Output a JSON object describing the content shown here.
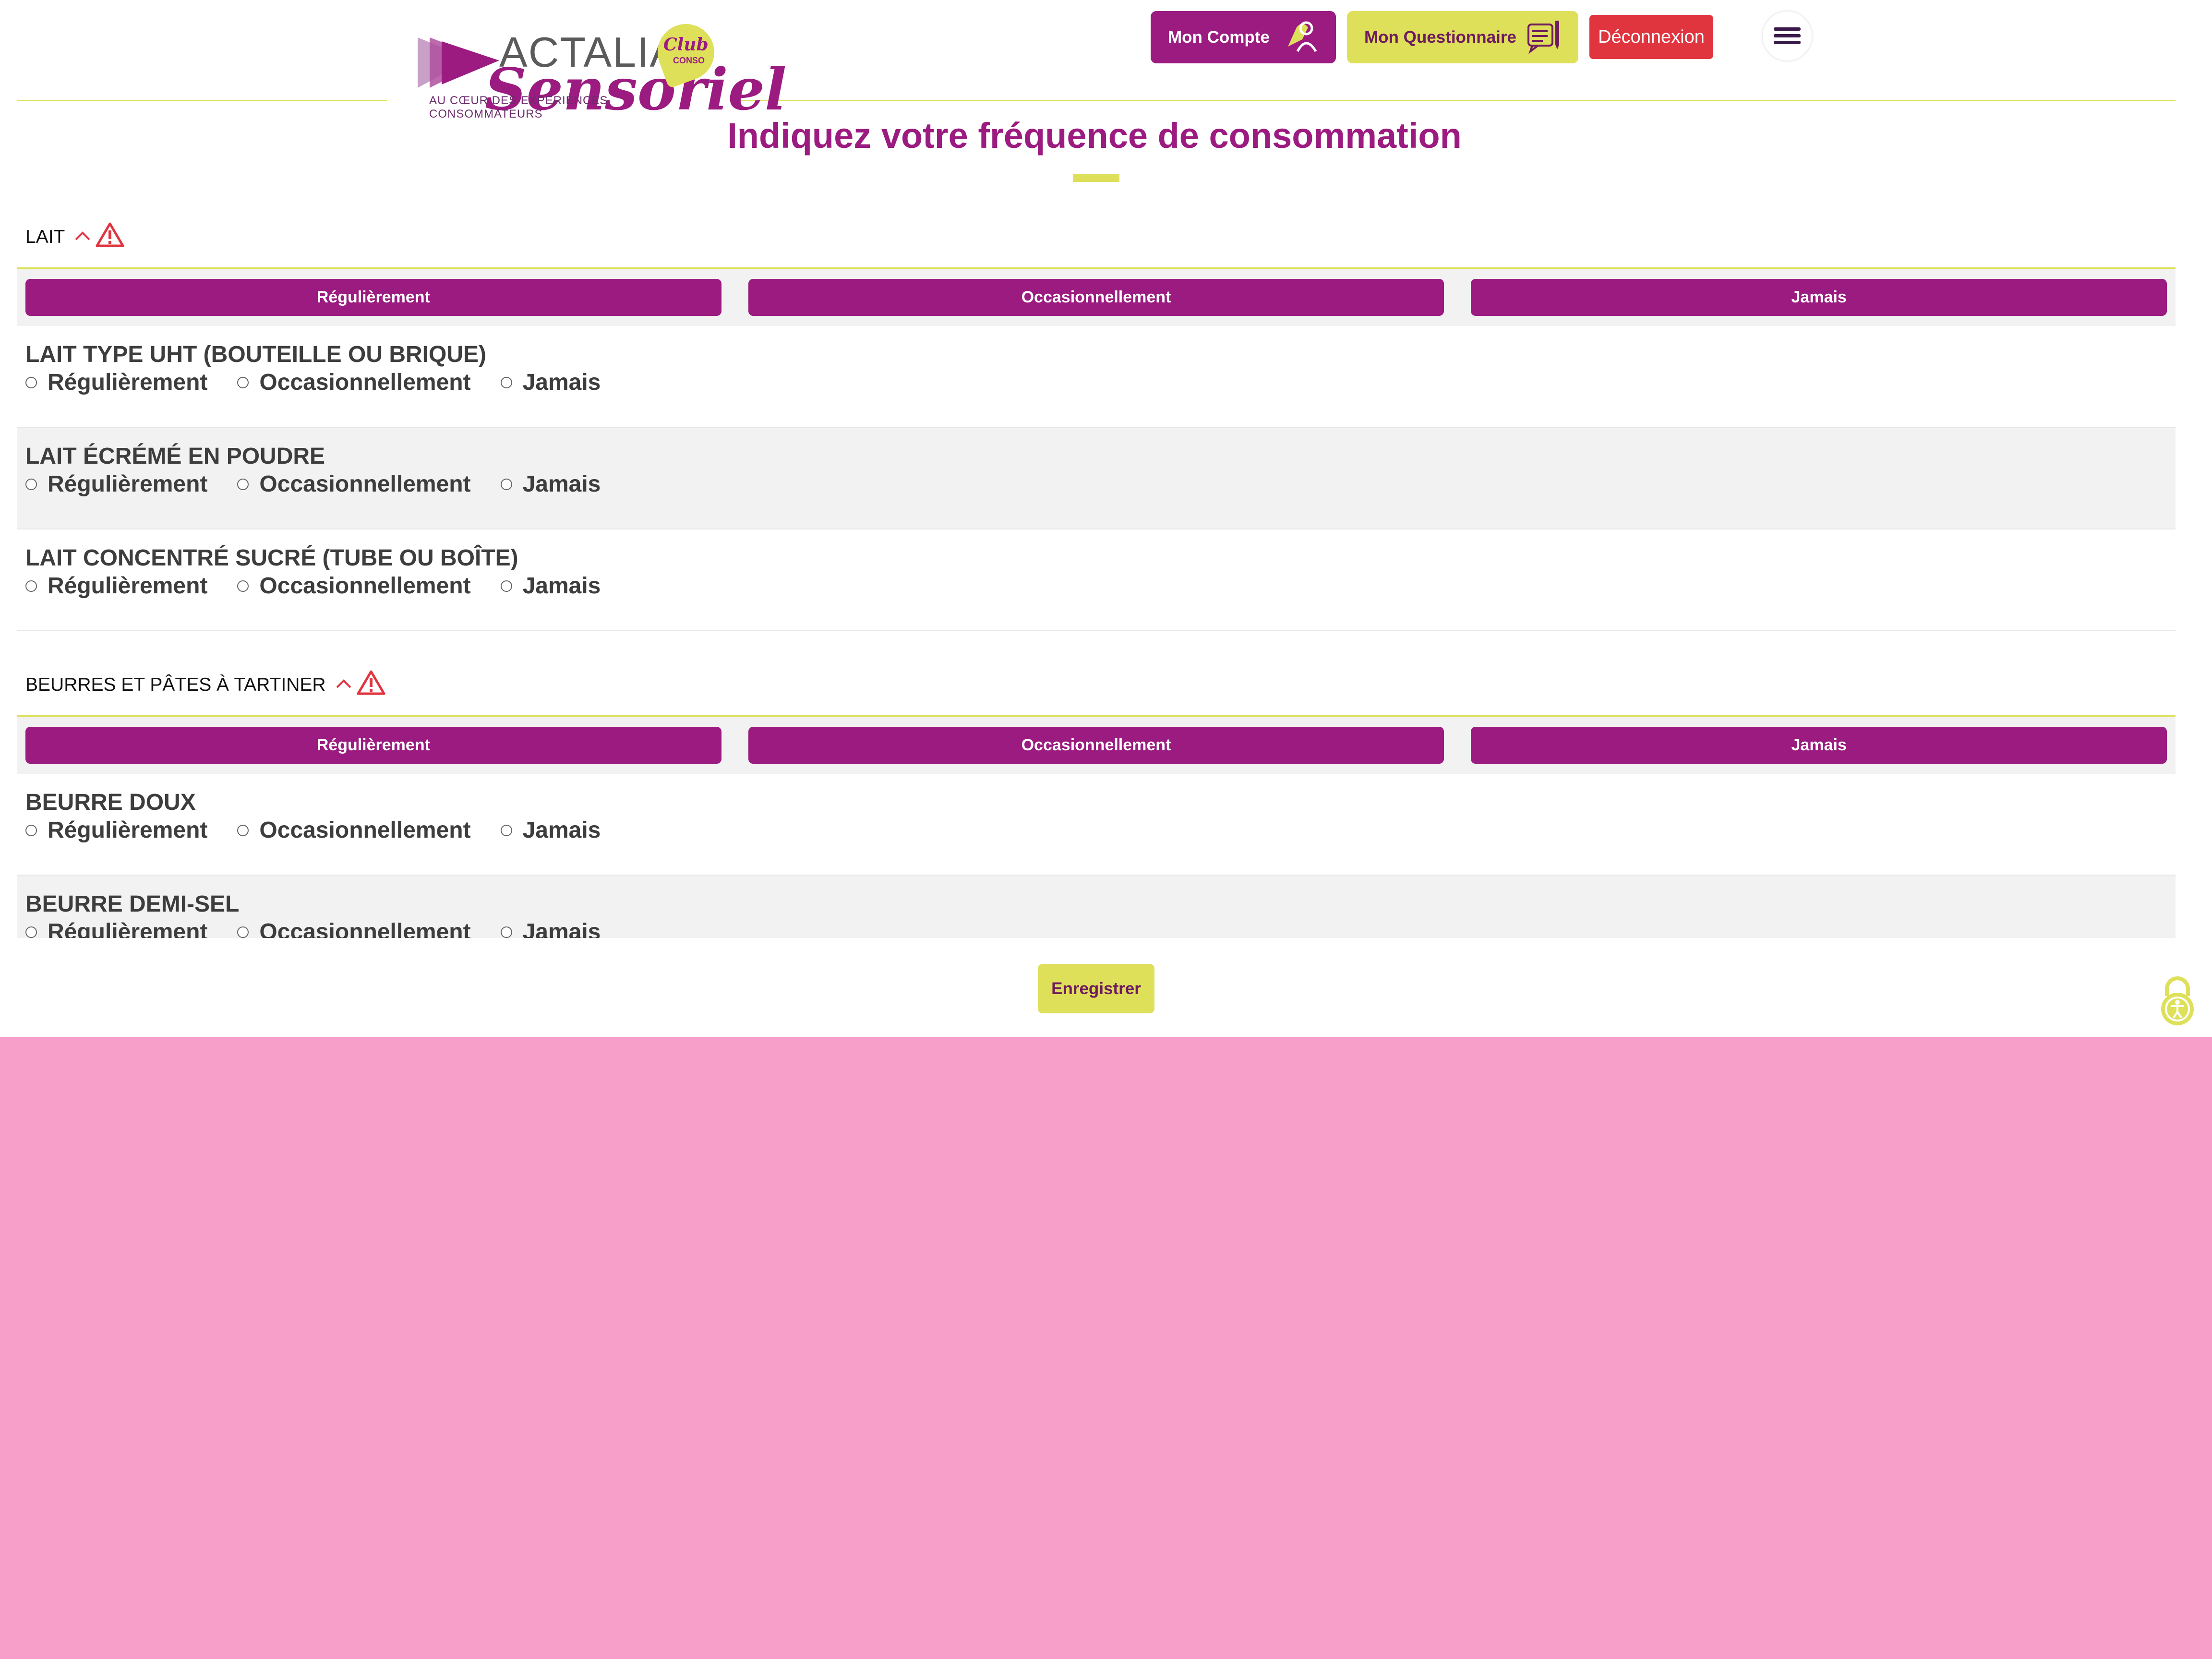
{
  "header": {
    "logo_wordmark": "ACTALIA",
    "logo_script": "Sensoriel",
    "logo_badge": "Club",
    "logo_badge_sub": "CONSO",
    "logo_tagline": "AU CŒUR DES EXPÉRIENCES CONSOMMATEURS",
    "buttons": {
      "account": "Mon Compte",
      "questionnaire": "Mon Questionnaire",
      "logout": "Déconnexion"
    },
    "menu_icon": "hamburger-icon"
  },
  "page": {
    "title": "Indiquez votre fréquence de consommation"
  },
  "options": [
    "Régulièrement",
    "Occasionnellement",
    "Jamais"
  ],
  "sections": [
    {
      "title": "LAIT",
      "items": [
        "LAIT TYPE UHT (BOUTEILLE OU BRIQUE)",
        "LAIT ÉCRÉMÉ EN POUDRE",
        "LAIT CONCENTRÉ SUCRÉ (TUBE OU BOÎTE)"
      ]
    },
    {
      "title": "BEURRES ET PÂTES À TARTINER",
      "items": [
        "BEURRE DOUX",
        "BEURRE DEMI-SEL"
      ]
    }
  ],
  "footer": {
    "save": "Enregistrer"
  },
  "colors": {
    "brand_purple": "#9b1b80",
    "brand_yellow": "#dfe05a",
    "danger_red": "#e0343f",
    "backdrop_pink": "#f79fc8"
  }
}
